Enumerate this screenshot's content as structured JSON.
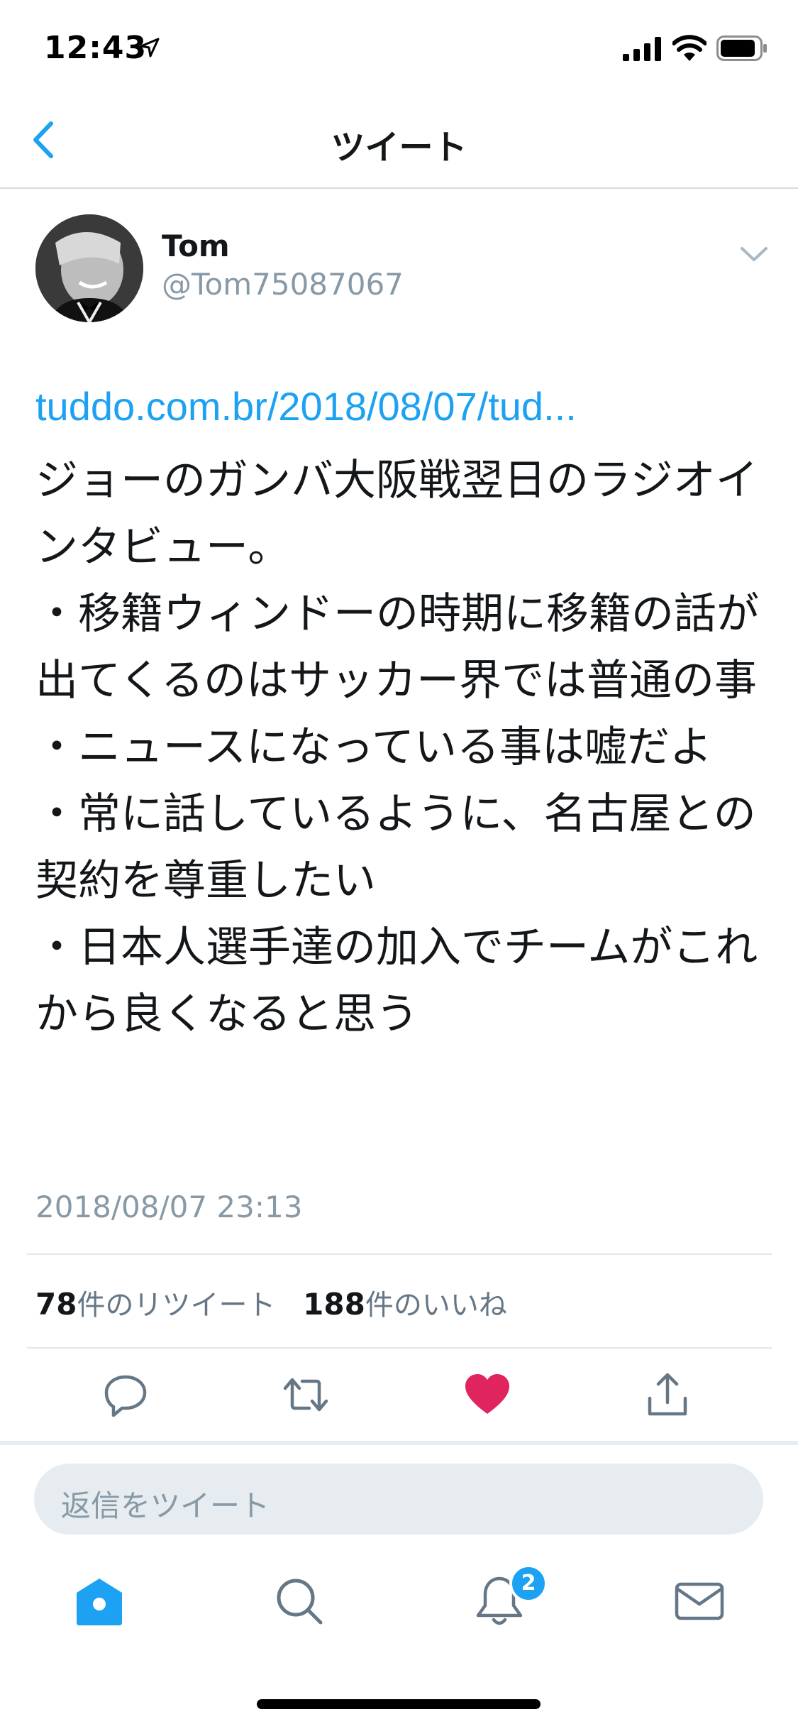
{
  "status_bar": {
    "time": "12:43"
  },
  "nav": {
    "title": "ツイート"
  },
  "tweet": {
    "author_name": "Tom",
    "author_handle": "@Tom75087067",
    "link": "tuddo.com.br/2018/08/07/tud...",
    "text": "ジョーのガンバ大阪戦翌日のラジオインタビュー。\n・移籍ウィンドーの時期に移籍の話が出てくるのはサッカー界では普通の事\n・ニュースになっている事は嘘だよ\n・常に話しているように、名古屋との契約を尊重したい\n・日本人選手達の加入でチームがこれから良くなると思う",
    "timestamp": "2018/08/07 23:13"
  },
  "stats": {
    "retweet_count": "78",
    "retweet_label": "件のリツイート",
    "like_count": "188",
    "like_label": "件のいいね"
  },
  "actions": {
    "reply_icon": "reply-icon",
    "retweet_icon": "retweet-icon",
    "like_icon": "heart-icon",
    "share_icon": "share-icon",
    "like_color": "#e0245e"
  },
  "reply": {
    "placeholder": "返信をツイート"
  },
  "tab_bar": {
    "notifications_badge": "2",
    "accent_color": "#1da1f2"
  }
}
